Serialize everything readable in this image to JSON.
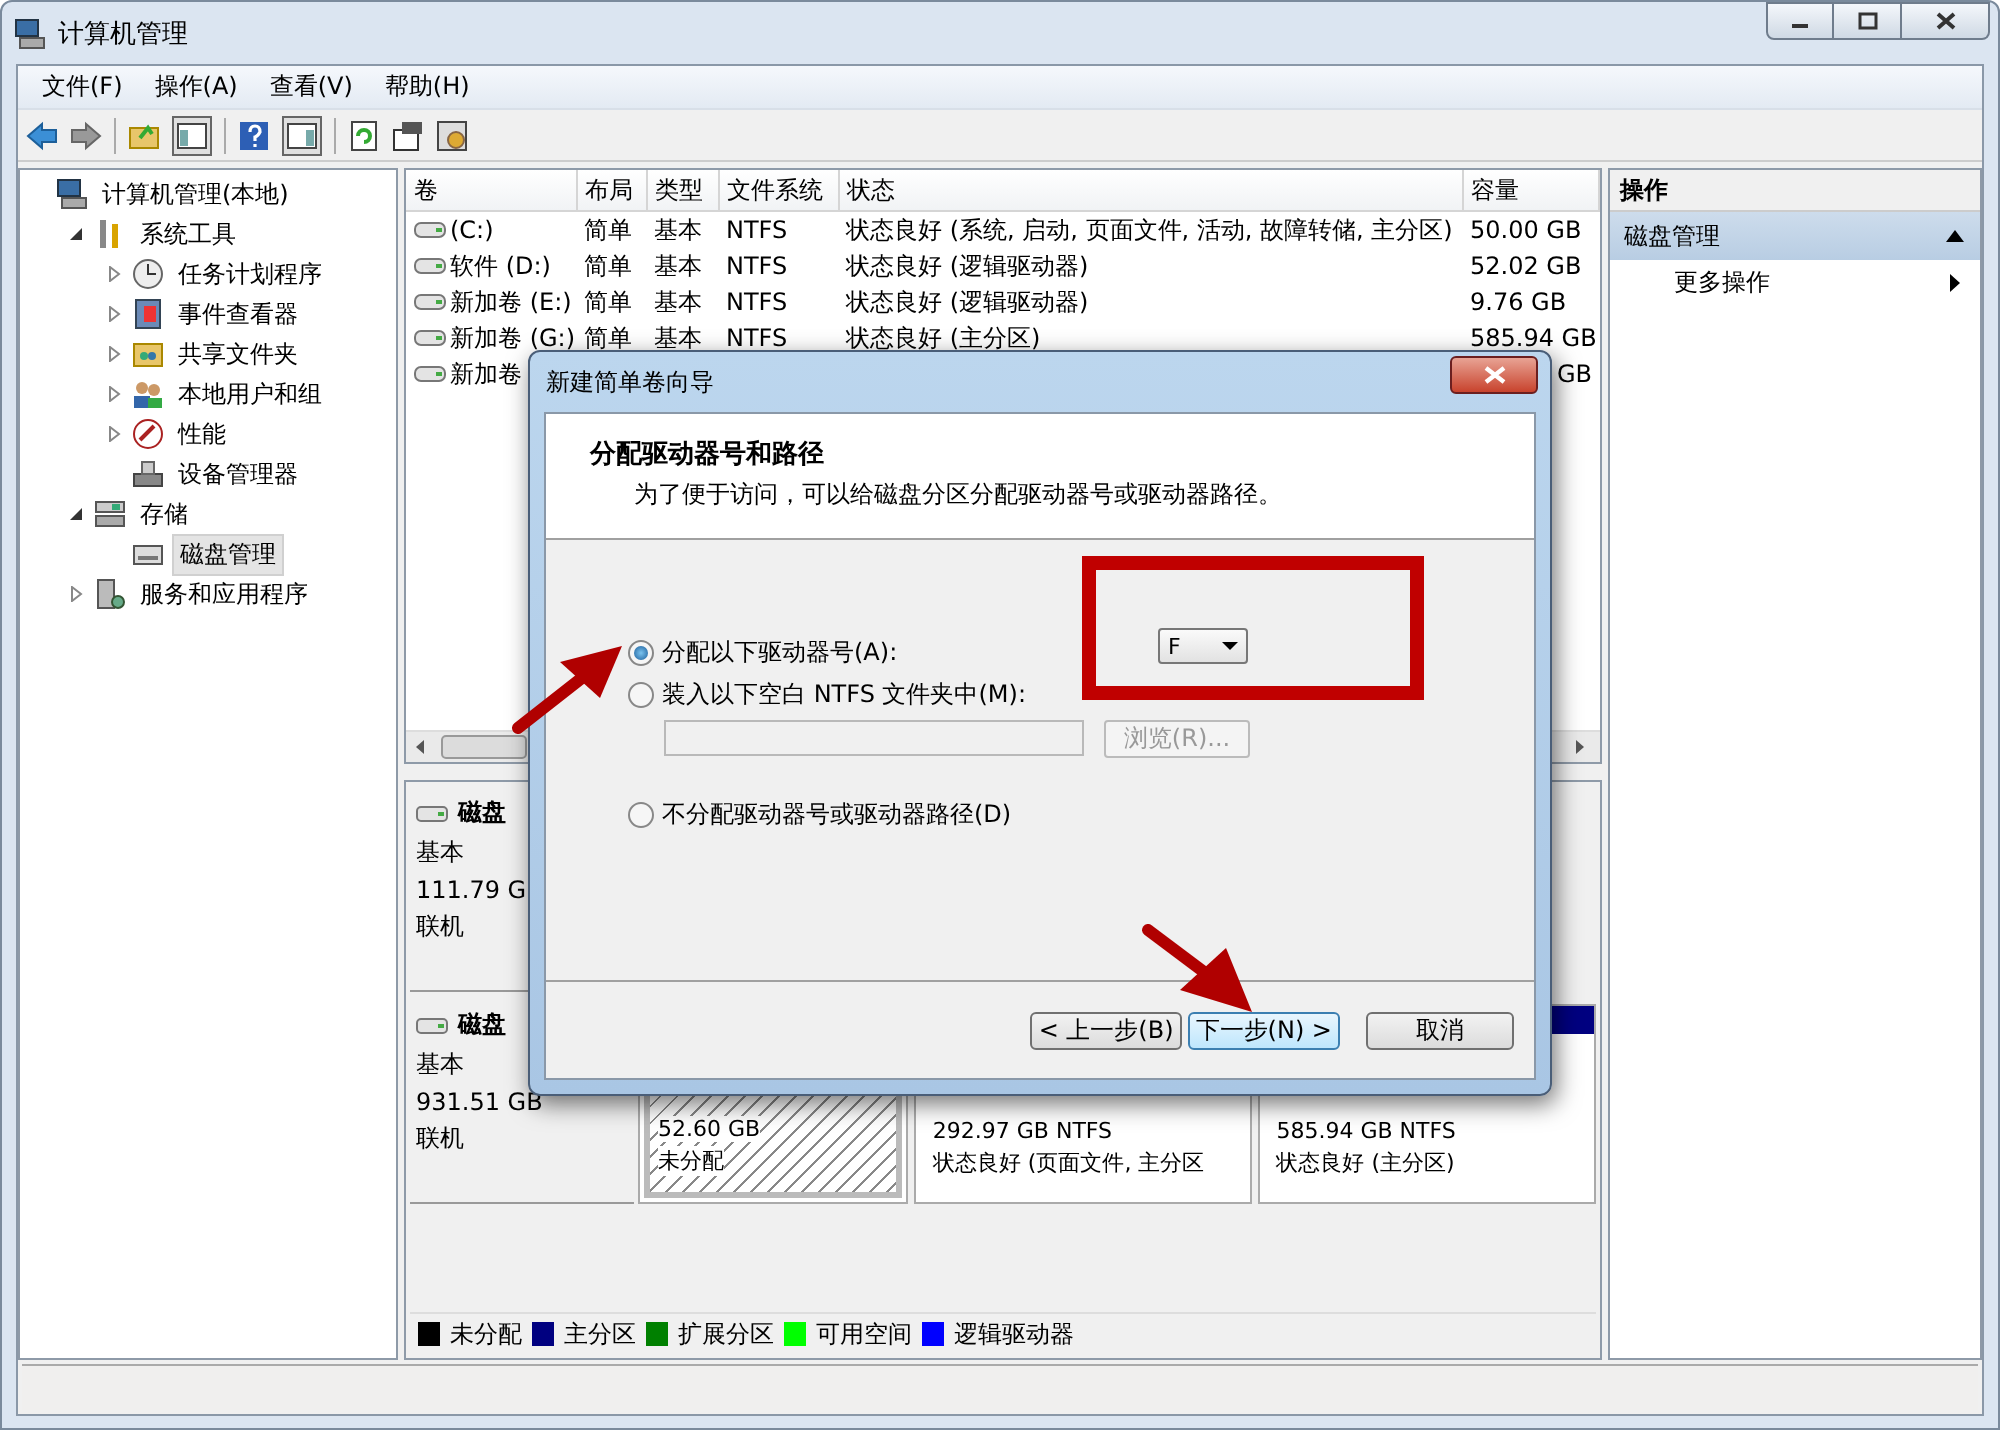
{
  "window": {
    "title": "计算机管理"
  },
  "menu": [
    "文件(F)",
    "操作(A)",
    "查看(V)",
    "帮助(H)"
  ],
  "tree": [
    {
      "label": "计算机管理(本地)",
      "selected": false,
      "children": [
        {
          "label": "系统工具",
          "expanded": true,
          "selected": false,
          "children": [
            {
              "label": "任务计划程序",
              "expanded": false,
              "selected": false
            },
            {
              "label": "事件查看器",
              "expanded": false,
              "selected": false
            },
            {
              "label": "共享文件夹",
              "expanded": false,
              "selected": false
            },
            {
              "label": "本地用户和组",
              "expanded": false,
              "selected": false
            },
            {
              "label": "性能",
              "expanded": false,
              "selected": false
            },
            {
              "label": "设备管理器",
              "selected": false
            }
          ]
        },
        {
          "label": "存储",
          "expanded": true,
          "selected": false,
          "children": [
            {
              "label": "磁盘管理",
              "selected": true
            }
          ]
        },
        {
          "label": "服务和应用程序",
          "expanded": false,
          "selected": false
        }
      ]
    }
  ],
  "table": {
    "columns": [
      "卷",
      "布局",
      "类型",
      "文件系统",
      "状态",
      "容量"
    ],
    "rows": [
      {
        "volume": "(C:)",
        "layout": "简单",
        "type": "基本",
        "fs": "NTFS",
        "status": "状态良好 (系统, 启动, 页面文件, 活动, 故障转储, 主分区)",
        "capacity": "50.00 GB"
      },
      {
        "volume": "软件 (D:)",
        "layout": "简单",
        "type": "基本",
        "fs": "NTFS",
        "status": "状态良好 (逻辑驱动器)",
        "capacity": "52.02 GB"
      },
      {
        "volume": "新加卷 (E:)",
        "layout": "简单",
        "type": "基本",
        "fs": "NTFS",
        "status": "状态良好 (逻辑驱动器)",
        "capacity": "9.76 GB"
      },
      {
        "volume": "新加卷 (G:)",
        "layout": "简单",
        "type": "基本",
        "fs": "NTFS",
        "status": "状态良好 (主分区)",
        "capacity": "585.94 GB"
      },
      {
        "volume": "新加卷",
        "capacity": "GB"
      }
    ]
  },
  "disks": {
    "items": [
      {
        "label": "磁盘",
        "type": "基本",
        "size": "111.79 G",
        "status": "联机"
      },
      {
        "label": "磁盘",
        "type": "基本",
        "size": "931.51 GB",
        "status": "联机",
        "partitions": [
          {
            "kind": "unallocated",
            "size": "52.60 GB",
            "status": "未分配"
          },
          {
            "kind": "primary",
            "size": "292.97 GB NTFS",
            "status": "状态良好 (页面文件, 主分区"
          },
          {
            "kind": "primary",
            "size": "585.94 GB NTFS",
            "status": "状态良好 (主分区)"
          }
        ]
      }
    ],
    "legend": [
      {
        "label": "未分配",
        "color": "#000000"
      },
      {
        "label": "主分区",
        "color": "#000080"
      },
      {
        "label": "扩展分区",
        "color": "#008000"
      },
      {
        "label": "可用空间",
        "color": "#00ff00"
      },
      {
        "label": "逻辑驱动器",
        "color": "#0000ff"
      }
    ]
  },
  "actions": {
    "title": "操作",
    "section": {
      "label": "磁盘管理",
      "expanded": true
    },
    "items": [
      "更多操作"
    ]
  },
  "dialog": {
    "title": "新建简单卷向导",
    "heading": "分配驱动器号和路径",
    "description": "为了便于访问，可以给磁盘分区分配驱动器号或驱动器路径。",
    "options": [
      {
        "label": "分配以下驱动器号(A):",
        "selected": true
      },
      {
        "label": "装入以下空白 NTFS 文件夹中(M):",
        "selected": false
      },
      {
        "label": "不分配驱动器号或驱动器路径(D)",
        "selected": false
      }
    ],
    "drive_letter": "F",
    "folder_path": {
      "disabled": true
    },
    "browse_button": {
      "label": "浏览(R)...",
      "disabled": true
    },
    "buttons": [
      {
        "label": "< 上一步(B)",
        "focused": false
      },
      {
        "label": "下一步(N) >",
        "focused": true
      },
      {
        "label": "取消",
        "focused": false
      }
    ]
  }
}
